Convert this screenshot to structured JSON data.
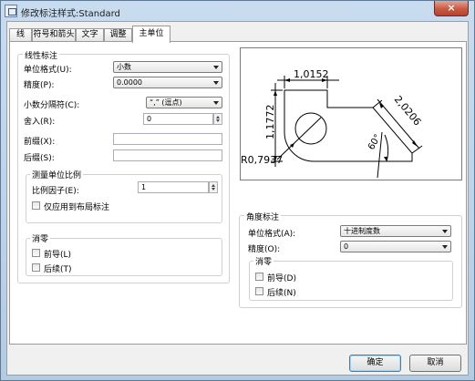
{
  "window": {
    "title": "修改标注样式:Standard",
    "close_glyph": "×"
  },
  "tabs": [
    {
      "label": "线"
    },
    {
      "label": "符号和箭头"
    },
    {
      "label": "文字"
    },
    {
      "label": "调整"
    },
    {
      "label": "主单位",
      "active": true
    }
  ],
  "linear": {
    "group_title": "线性标注",
    "unit_format_label": "单位格式(U):",
    "unit_format_value": "小数",
    "precision_label": "精度(P):",
    "precision_value": "0.0000",
    "decimal_sep_label": "小数分隔符(C):",
    "decimal_sep_value": "“,” (逗点)",
    "round_off_label": "舍入(R):",
    "round_off_value": "0",
    "prefix_label": "前缀(X):",
    "prefix_value": "",
    "suffix_label": "后缀(S):",
    "suffix_value": ""
  },
  "scale": {
    "group_title": "测量单位比例",
    "factor_label": "比例因子(E):",
    "factor_value": "1",
    "layout_only_label": "仅应用到布局标注"
  },
  "zero_left": {
    "group_title": "消零",
    "leading_label": "前导(L)",
    "trailing_label": "后续(T)"
  },
  "preview": {
    "dim_top": "1,0152",
    "dim_left": "1,1772",
    "dim_right": "2,0206",
    "radius": "R0,7937",
    "angle": "60°"
  },
  "angular": {
    "group_title": "角度标注",
    "unit_format_label": "单位格式(A):",
    "unit_format_value": "十进制度数",
    "precision_label": "精度(O):",
    "precision_value": "0",
    "zero_title": "消零",
    "leading_label": "前导(D)",
    "trailing_label": "后续(N)"
  },
  "buttons": {
    "ok": "确定",
    "cancel": "取消"
  }
}
